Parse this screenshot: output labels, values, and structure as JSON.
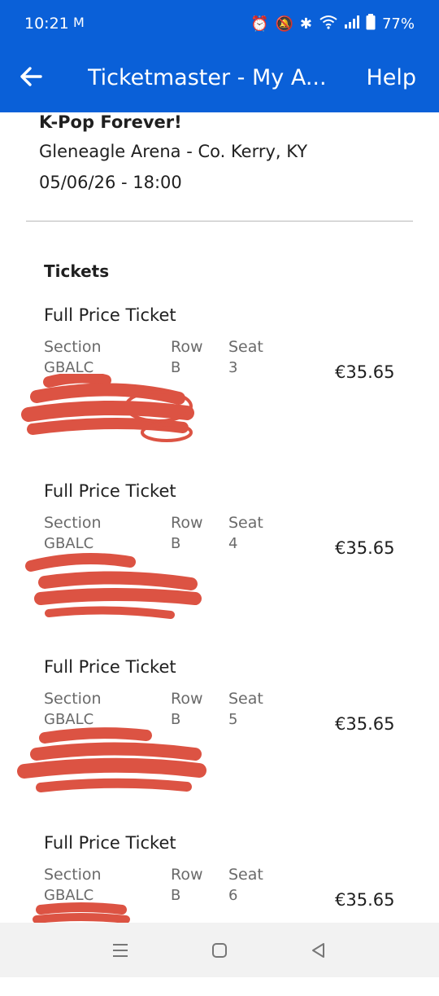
{
  "status": {
    "time": "10:21",
    "mail_icon": "M",
    "battery": "77%"
  },
  "app_bar": {
    "title": "Ticketmaster - My A...",
    "help": "Help"
  },
  "event": {
    "name": "K-Pop Forever!",
    "venue": "Gleneagle Arena - Co. Kerry, KY",
    "datetime": "05/06/26 - 18:00"
  },
  "tickets_heading": "Tickets",
  "labels": {
    "section": "Section",
    "row": "Row",
    "seat": "Seat"
  },
  "tickets": [
    {
      "type": "Full Price Ticket",
      "section": "GBALC",
      "row": "B",
      "seat": "3",
      "price": "€35.65"
    },
    {
      "type": "Full Price Ticket",
      "section": "GBALC",
      "row": "B",
      "seat": "4",
      "price": "€35.65"
    },
    {
      "type": "Full Price Ticket",
      "section": "GBALC",
      "row": "B",
      "seat": "5",
      "price": "€35.65"
    },
    {
      "type": "Full Price Ticket",
      "section": "GBALC",
      "row": "B",
      "seat": "6",
      "price": "€35.65"
    }
  ],
  "colors": {
    "brand": "#0a60d8",
    "redaction": "#d9412f"
  }
}
